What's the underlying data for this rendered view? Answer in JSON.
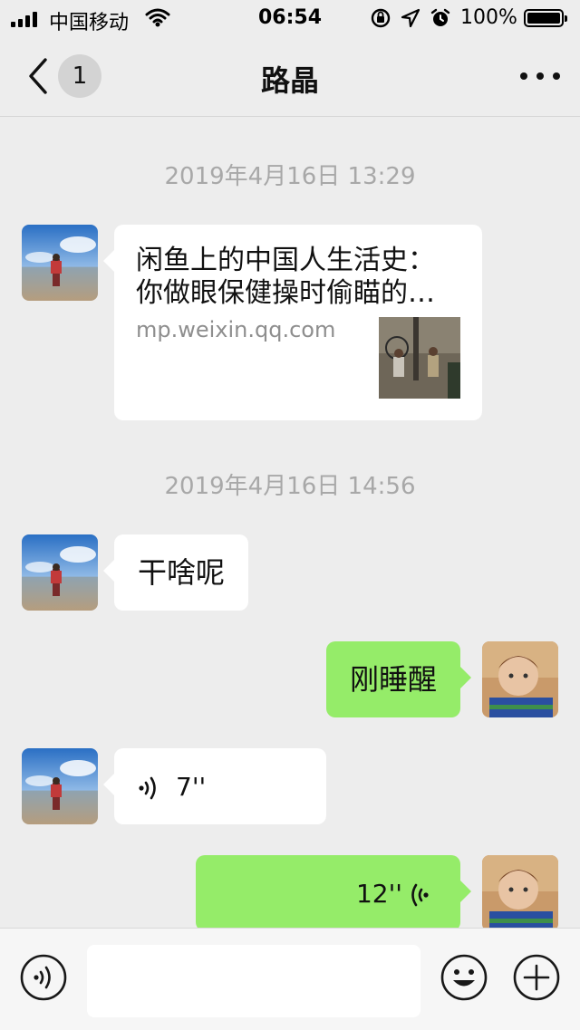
{
  "status_bar": {
    "carrier": "中国移动",
    "time": "06:54",
    "battery": "100%"
  },
  "nav": {
    "back_badge": "1",
    "title": "路晶"
  },
  "messages": [
    {
      "type": "timestamp",
      "text": "2019年4月16日 13:29"
    },
    {
      "type": "link",
      "side": "left",
      "title": "闲鱼上的中国人生活史：你做眼保健操时偷瞄的…",
      "source": "mp.weixin.qq.com"
    },
    {
      "type": "timestamp",
      "text": "2019年4月16日 14:56"
    },
    {
      "type": "text",
      "side": "left",
      "text": "干啥呢"
    },
    {
      "type": "text",
      "side": "right",
      "text": "刚睡醒"
    },
    {
      "type": "voice",
      "side": "left",
      "duration": "7''"
    },
    {
      "type": "voice",
      "side": "right",
      "duration": "12''"
    }
  ],
  "icons": {
    "back": "chevron-left-icon",
    "more": "more-dots-icon",
    "voice_mode": "voice-input-icon",
    "emoji": "emoji-icon",
    "plus": "plus-icon"
  },
  "colors": {
    "background": "#ededed",
    "self_bubble": "#95ec69",
    "other_bubble": "#ffffff",
    "timestamp": "#a8a8a8"
  },
  "input": {
    "value": ""
  }
}
